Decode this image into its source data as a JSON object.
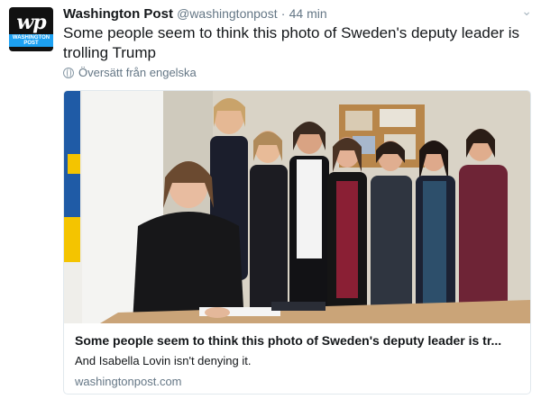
{
  "tweet": {
    "author_name": "Washington Post",
    "handle": "@washingtonpost",
    "separator": "·",
    "time": "44 min",
    "text": "Some people seem to think this photo of Sweden's deputy leader is trolling Trump",
    "translate_label": "Översätt från engelska",
    "avatar": {
      "logo": "wp",
      "label": "WASHINGTON POST"
    }
  },
  "card": {
    "title": "Some people seem to think this photo of Sweden's deputy leader is tr...",
    "description": "And Isabella Lovin isn't denying it.",
    "domain": "washingtonpost.com"
  },
  "colors": {
    "text": "#14171a",
    "meta": "#657786",
    "border": "#e1e8ed",
    "flag_blue": "#1f5ba6",
    "flag_yellow": "#f4c400"
  }
}
